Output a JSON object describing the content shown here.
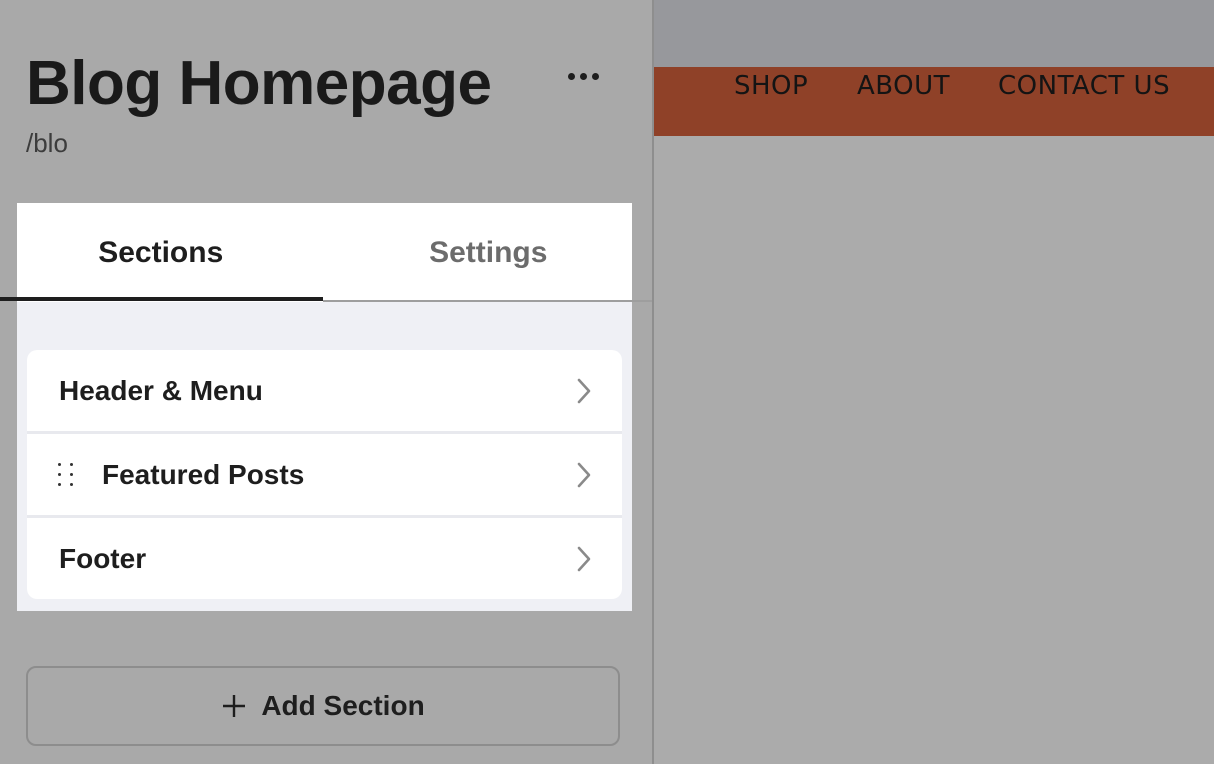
{
  "editor": {
    "page_title": "Blog Homepage",
    "page_slug": "/blo",
    "more_icon": "more-horizontal-icon",
    "tabs": [
      {
        "label": "Sections",
        "active": true
      },
      {
        "label": "Settings",
        "active": false
      }
    ],
    "sections": [
      {
        "label": "Header & Menu",
        "draggable": false
      },
      {
        "label": "Featured Posts",
        "draggable": true
      },
      {
        "label": "Footer",
        "draggable": false
      }
    ],
    "add_section_label": "Add Section"
  },
  "preview": {
    "nav_links": [
      "SHOP",
      "ABOUT",
      "CONTACT US"
    ],
    "nav_color": "#8f4128"
  },
  "colors": {
    "active_tab_underline": "#1e1e1e",
    "panel_bg": "#a9a9a9"
  }
}
